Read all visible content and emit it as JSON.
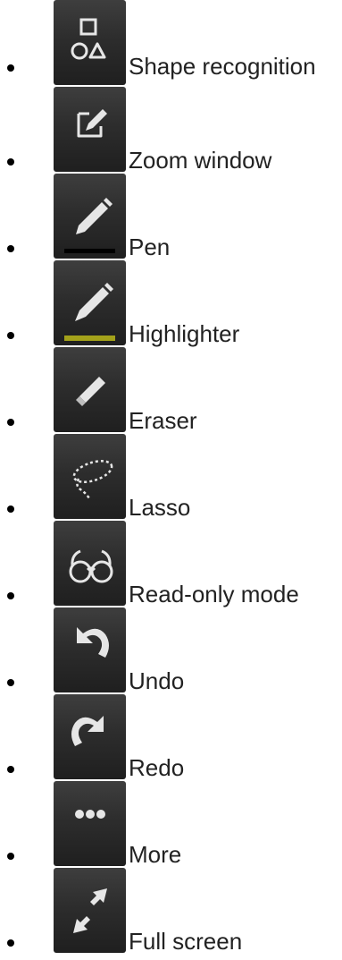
{
  "tools": [
    {
      "label": "Shape recognition",
      "icon": "shapes-icon"
    },
    {
      "label": "Zoom window",
      "icon": "zoom-window-icon"
    },
    {
      "label": "Pen",
      "icon": "pen-icon",
      "color": "#000000"
    },
    {
      "label": "Highlighter",
      "icon": "highlighter-icon",
      "color": "#a3a11a"
    },
    {
      "label": "Eraser",
      "icon": "eraser-icon"
    },
    {
      "label": "Lasso",
      "icon": "lasso-icon"
    },
    {
      "label": "Read-only mode",
      "icon": "glasses-icon"
    },
    {
      "label": "Undo",
      "icon": "undo-icon"
    },
    {
      "label": "Redo",
      "icon": "redo-icon"
    },
    {
      "label": "More",
      "icon": "more-dots-icon"
    },
    {
      "label": "Full screen",
      "icon": "fullscreen-arrows-icon"
    }
  ],
  "colors": {
    "button_bg": "#2d2d2d",
    "icon_fg": "#e6e6e6",
    "text": "#222222",
    "highlighter": "#a3a11a"
  }
}
